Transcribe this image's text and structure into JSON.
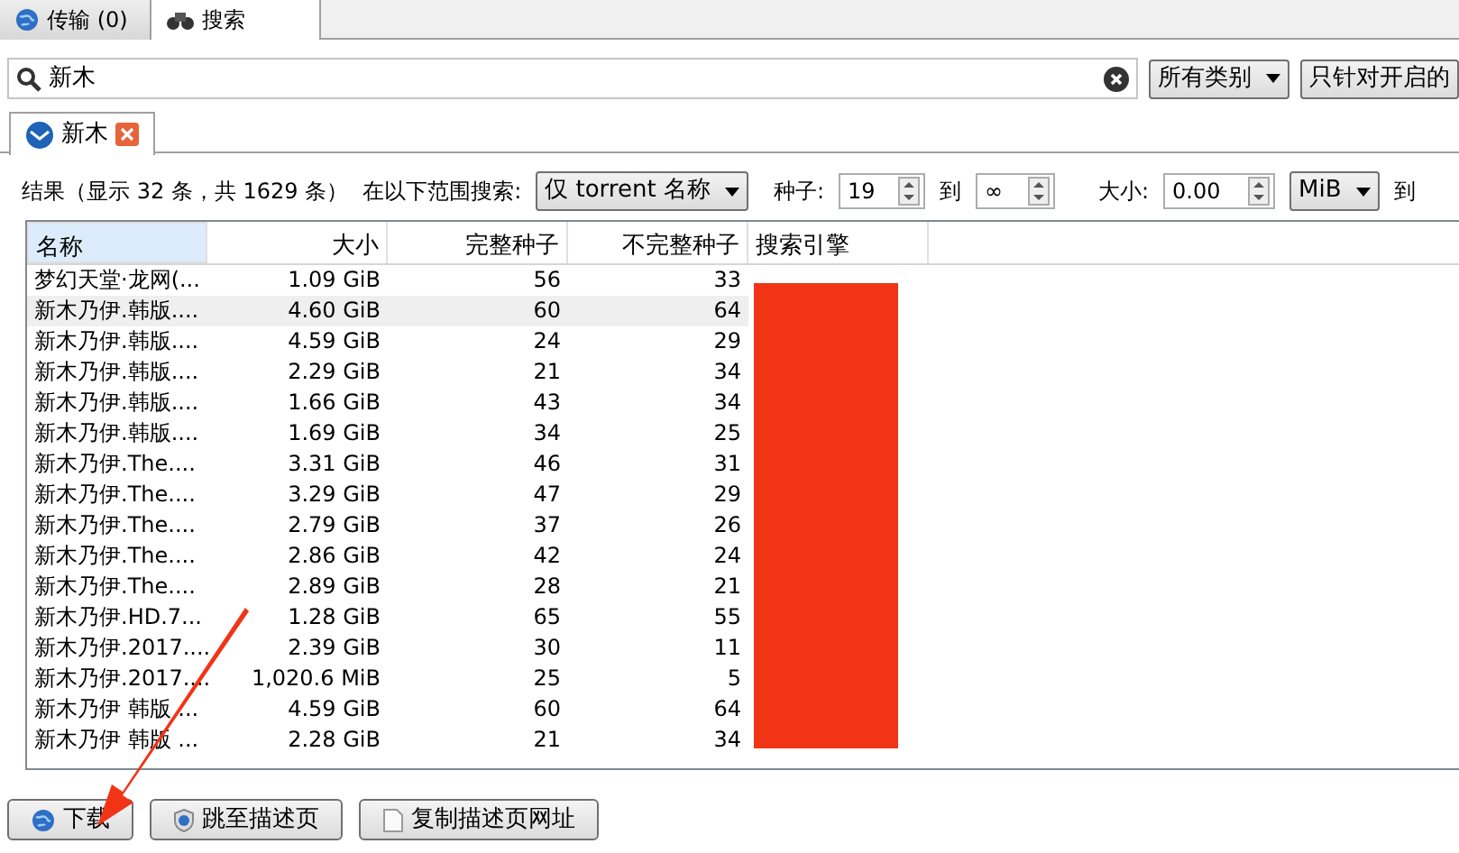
{
  "top_tabs": [
    {
      "label": "传输 (0)",
      "selected": false
    },
    {
      "label": "搜索",
      "selected": true
    }
  ],
  "search": {
    "value": "新木",
    "category": "所有类别",
    "plugins": "只针对开启的"
  },
  "result_tabs": [
    {
      "label": "新木",
      "selected": true
    }
  ],
  "filter": {
    "results": "结果（显示 32 条，共 1629 条）",
    "scope_label": "在以下范围搜索:",
    "scope": "仅 torrent 名称",
    "seeds_label": "种子:",
    "seeds_min": "19",
    "to1": "到",
    "seeds_max": "∞",
    "size_label": "大小:",
    "size_min": "0.00",
    "unit": "MiB",
    "to2": "到"
  },
  "table": {
    "columns": [
      "名称",
      "大小",
      "完整种子",
      "不完整种子",
      "搜索引擎"
    ],
    "rows": [
      {
        "name": "梦幻天堂·龙网(...",
        "size": "1.09 GiB",
        "seeds": "56",
        "leechers": "33",
        "selected": false
      },
      {
        "name": "新木乃伊.韩版....",
        "size": "4.60 GiB",
        "seeds": "60",
        "leechers": "64",
        "selected": true
      },
      {
        "name": "新木乃伊.韩版....",
        "size": "4.59 GiB",
        "seeds": "24",
        "leechers": "29",
        "selected": false
      },
      {
        "name": "新木乃伊.韩版....",
        "size": "2.29 GiB",
        "seeds": "21",
        "leechers": "34",
        "selected": false
      },
      {
        "name": "新木乃伊.韩版....",
        "size": "1.66 GiB",
        "seeds": "43",
        "leechers": "34",
        "selected": false
      },
      {
        "name": "新木乃伊.韩版....",
        "size": "1.69 GiB",
        "seeds": "34",
        "leechers": "25",
        "selected": false
      },
      {
        "name": "新木乃伊.The....",
        "size": "3.31 GiB",
        "seeds": "46",
        "leechers": "31",
        "selected": false
      },
      {
        "name": "新木乃伊.The....",
        "size": "3.29 GiB",
        "seeds": "47",
        "leechers": "29",
        "selected": false
      },
      {
        "name": "新木乃伊.The....",
        "size": "2.79 GiB",
        "seeds": "37",
        "leechers": "26",
        "selected": false
      },
      {
        "name": "新木乃伊.The....",
        "size": "2.86 GiB",
        "seeds": "42",
        "leechers": "24",
        "selected": false
      },
      {
        "name": "新木乃伊.The....",
        "size": "2.89 GiB",
        "seeds": "28",
        "leechers": "21",
        "selected": false
      },
      {
        "name": "新木乃伊.HD.7...",
        "size": "1.28 GiB",
        "seeds": "65",
        "leechers": "55",
        "selected": false
      },
      {
        "name": "新木乃伊.2017....",
        "size": "2.39 GiB",
        "seeds": "30",
        "leechers": "11",
        "selected": false
      },
      {
        "name": "新木乃伊.2017....",
        "size": "1,020.6 MiB",
        "seeds": "25",
        "leechers": "5",
        "selected": false
      },
      {
        "name": "新木乃伊 韩版 ...",
        "size": "4.59 GiB",
        "seeds": "60",
        "leechers": "64",
        "selected": false
      },
      {
        "name": "新木乃伊 韩版 ...",
        "size": "2.28 GiB",
        "seeds": "21",
        "leechers": "34",
        "selected": false
      }
    ]
  },
  "buttons": [
    {
      "label": "下载"
    },
    {
      "label": "跳至描述页"
    },
    {
      "label": "复制描述页网址"
    }
  ]
}
